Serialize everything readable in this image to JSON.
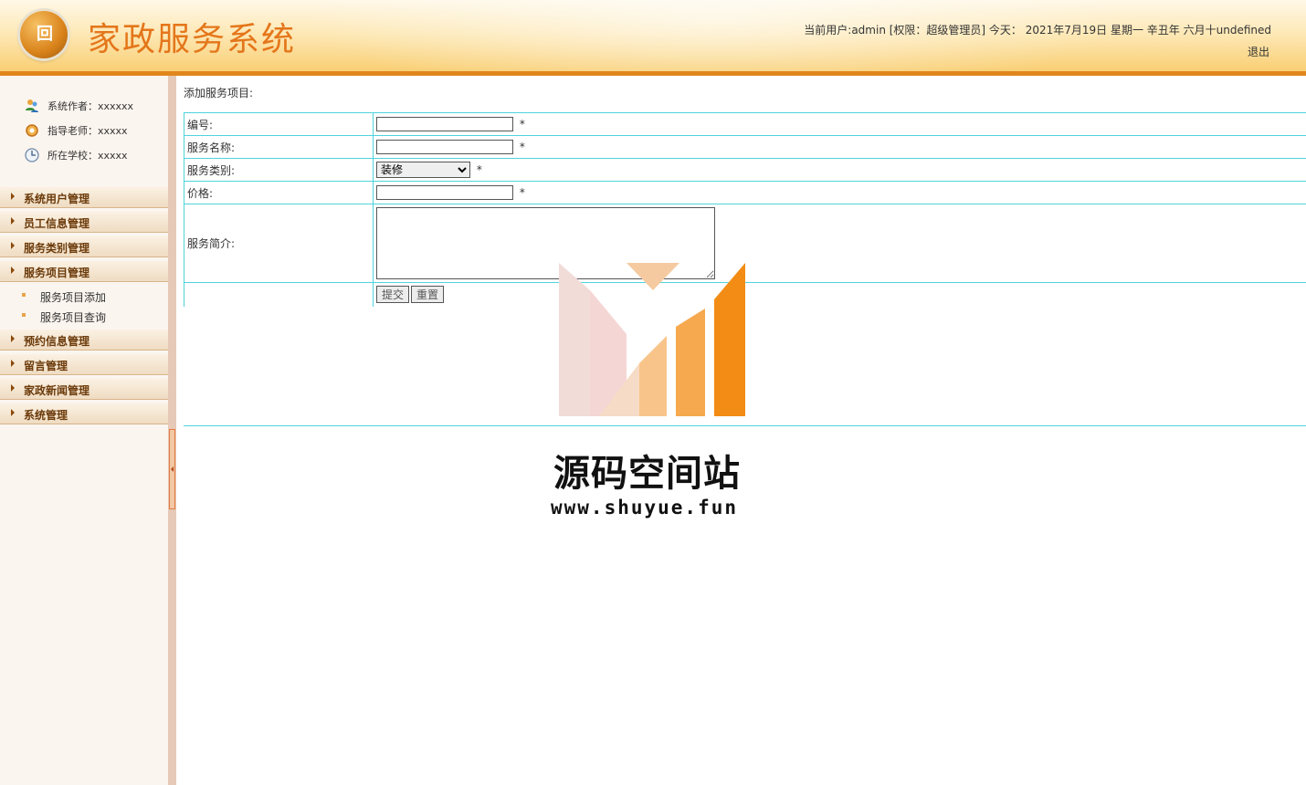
{
  "header": {
    "title": "家政服务系统",
    "userline": "当前用户:admin [权限：超级管理员] 今天： 2021年7月19日 星期一 辛丑年 六月十undefined",
    "logout": "退出"
  },
  "sidebar": {
    "info": [
      {
        "label": "系统作者：xxxxxx",
        "icon": "people-icon"
      },
      {
        "label": "指导老师：xxxxx",
        "icon": "teacher-icon"
      },
      {
        "label": "所在学校：xxxxx",
        "icon": "clock-icon"
      }
    ],
    "menu": [
      {
        "label": "系统用户管理"
      },
      {
        "label": "员工信息管理"
      },
      {
        "label": "服务类别管理"
      },
      {
        "label": "服务项目管理",
        "children": [
          "服务项目添加",
          "服务项目查询"
        ]
      },
      {
        "label": "预约信息管理"
      },
      {
        "label": "留言管理"
      },
      {
        "label": "家政新闻管理"
      },
      {
        "label": "系统管理"
      }
    ]
  },
  "main": {
    "heading": "添加服务项目:",
    "fields": {
      "code": {
        "label": "编号:",
        "value": "",
        "required": "*"
      },
      "name": {
        "label": "服务名称:",
        "value": "",
        "required": "*"
      },
      "category": {
        "label": "服务类别:",
        "selected": "装修",
        "required": "*"
      },
      "price": {
        "label": "价格:",
        "value": "",
        "required": "*"
      },
      "intro": {
        "label": "服务简介:",
        "value": ""
      }
    },
    "buttons": {
      "submit": "提交",
      "reset": "重置"
    }
  },
  "watermark": {
    "title": "源码空间站",
    "url": "www.shuyue.fun"
  },
  "colors": {
    "accent": "#e4761a",
    "table_border": "#4fd3dc",
    "menu_text": "#6b3a0a"
  }
}
